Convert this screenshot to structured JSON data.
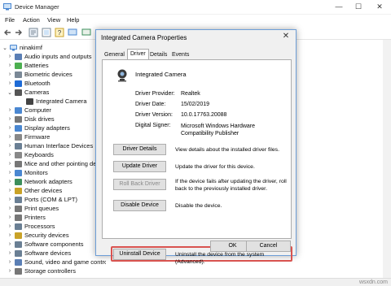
{
  "device_manager": {
    "title": "Device Manager",
    "menu": [
      "File",
      "Action",
      "View",
      "Help"
    ],
    "tree_root": "ninakimf",
    "tree": [
      {
        "label": "Audio inputs and outputs",
        "chevron": "›",
        "icon_color": "#5b7fb5"
      },
      {
        "label": "Batteries",
        "chevron": "›",
        "icon_color": "#4caf50"
      },
      {
        "label": "Biometric devices",
        "chevron": "›",
        "icon_color": "#7a8896"
      },
      {
        "label": "Bluetooth",
        "chevron": "›",
        "icon_color": "#1e6bd6"
      },
      {
        "label": "Cameras",
        "chevron": "⌄",
        "icon_color": "#555555"
      },
      {
        "label": "Integrated Camera",
        "chevron": "",
        "icon_color": "#444444",
        "child": true
      },
      {
        "label": "Computer",
        "chevron": "›",
        "icon_color": "#4a87d1"
      },
      {
        "label": "Disk drives",
        "chevron": "›",
        "icon_color": "#777777"
      },
      {
        "label": "Display adapters",
        "chevron": "›",
        "icon_color": "#4a87d1"
      },
      {
        "label": "Firmware",
        "chevron": "›",
        "icon_color": "#888888"
      },
      {
        "label": "Human Interface Devices",
        "chevron": "›",
        "icon_color": "#6a7f94"
      },
      {
        "label": "Keyboards",
        "chevron": "›",
        "icon_color": "#888888"
      },
      {
        "label": "Mice and other pointing devices",
        "chevron": "›",
        "icon_color": "#777777"
      },
      {
        "label": "Monitors",
        "chevron": "›",
        "icon_color": "#4a87d1"
      },
      {
        "label": "Network adapters",
        "chevron": "›",
        "icon_color": "#3d8f5c"
      },
      {
        "label": "Other devices",
        "chevron": "›",
        "icon_color": "#c9a227"
      },
      {
        "label": "Ports (COM & LPT)",
        "chevron": "›",
        "icon_color": "#6a7f94"
      },
      {
        "label": "Print queues",
        "chevron": "›",
        "icon_color": "#777777"
      },
      {
        "label": "Printers",
        "chevron": "›",
        "icon_color": "#777777"
      },
      {
        "label": "Processors",
        "chevron": "›",
        "icon_color": "#6a7f94"
      },
      {
        "label": "Security devices",
        "chevron": "›",
        "icon_color": "#c9a227"
      },
      {
        "label": "Software components",
        "chevron": "›",
        "icon_color": "#6a7f94"
      },
      {
        "label": "Software devices",
        "chevron": "›",
        "icon_color": "#6a7f94"
      },
      {
        "label": "Sound, video and game controllers",
        "chevron": "›",
        "icon_color": "#5b7fb5"
      },
      {
        "label": "Storage controllers",
        "chevron": "›",
        "icon_color": "#777777"
      }
    ]
  },
  "dialog": {
    "title": "Integrated Camera Properties",
    "tabs": [
      "General",
      "Driver",
      "Details",
      "Events"
    ],
    "active_tab": "Driver",
    "device_name": "Integrated Camera",
    "properties": [
      {
        "label": "Driver Provider:",
        "value": "Realtek"
      },
      {
        "label": "Driver Date:",
        "value": "15/02/2019"
      },
      {
        "label": "Driver Version:",
        "value": "10.0.17763.20088"
      },
      {
        "label": "Digital Signer:",
        "value": "Microsoft Windows Hardware Compatibility Publisher"
      }
    ],
    "actions": [
      {
        "button": "Driver Details",
        "description": "View details about the installed driver files.",
        "enabled": true
      },
      {
        "button": "Update Driver",
        "description": "Update the driver for this device.",
        "enabled": true
      },
      {
        "button": "Roll Back Driver",
        "description": "If the device fails after updating the driver, roll back to the previously installed driver.",
        "enabled": false
      },
      {
        "button": "Disable Device",
        "description": "Disable the device.",
        "enabled": true
      },
      {
        "button": "Uninstall Device",
        "description": "Uninstall the device from the system (Advanced).",
        "enabled": true
      }
    ],
    "ok": "OK",
    "cancel": "Cancel"
  },
  "watermark": "wsxdn.com",
  "colors": {
    "highlight": "#d9534f",
    "dialog_border": "#6d9ed7"
  }
}
